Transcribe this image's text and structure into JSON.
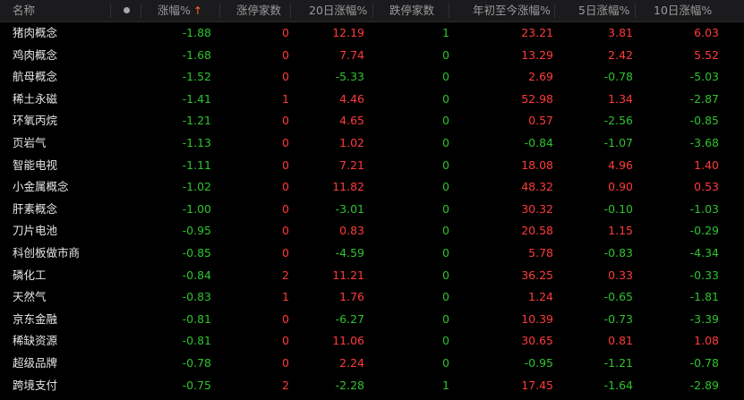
{
  "colors": {
    "up": "#ff3a3a",
    "down": "#2ec22e",
    "neutral": "#e6e6e6",
    "sort_arrow": "#ff6a2b"
  },
  "header": {
    "name": "名称",
    "dot": "dot-icon",
    "chg": "涨幅%",
    "sort_arrow": "↑",
    "limit_up": "涨停家数",
    "chg20": "20日涨幅%",
    "limit_down": "跌停家数",
    "ytd": "年初至今涨幅%",
    "chg5": "5日涨幅%",
    "chg10": "10日涨幅%"
  },
  "rows": [
    {
      "name": "猪肉概念",
      "chg": "-1.88",
      "limit_up": "0",
      "chg20": "12.19",
      "limit_down": "1",
      "ytd": "23.21",
      "chg5": "3.81",
      "chg10": "6.03"
    },
    {
      "name": "鸡肉概念",
      "chg": "-1.68",
      "limit_up": "0",
      "chg20": "7.74",
      "limit_down": "0",
      "ytd": "13.29",
      "chg5": "2.42",
      "chg10": "5.52"
    },
    {
      "name": "航母概念",
      "chg": "-1.52",
      "limit_up": "0",
      "chg20": "-5.33",
      "limit_down": "0",
      "ytd": "2.69",
      "chg5": "-0.78",
      "chg10": "-5.03"
    },
    {
      "name": "稀土永磁",
      "chg": "-1.41",
      "limit_up": "1",
      "chg20": "4.46",
      "limit_down": "0",
      "ytd": "52.98",
      "chg5": "1.34",
      "chg10": "-2.87"
    },
    {
      "name": "环氧丙烷",
      "chg": "-1.21",
      "limit_up": "0",
      "chg20": "4.65",
      "limit_down": "0",
      "ytd": "0.57",
      "chg5": "-2.56",
      "chg10": "-0.85"
    },
    {
      "name": "页岩气",
      "chg": "-1.13",
      "limit_up": "0",
      "chg20": "1.02",
      "limit_down": "0",
      "ytd": "-0.84",
      "chg5": "-1.07",
      "chg10": "-3.68"
    },
    {
      "name": "智能电视",
      "chg": "-1.11",
      "limit_up": "0",
      "chg20": "7.21",
      "limit_down": "0",
      "ytd": "18.08",
      "chg5": "4.96",
      "chg10": "1.40"
    },
    {
      "name": "小金属概念",
      "chg": "-1.02",
      "limit_up": "0",
      "chg20": "11.82",
      "limit_down": "0",
      "ytd": "48.32",
      "chg5": "0.90",
      "chg10": "0.53"
    },
    {
      "name": "肝素概念",
      "chg": "-1.00",
      "limit_up": "0",
      "chg20": "-3.01",
      "limit_down": "0",
      "ytd": "30.32",
      "chg5": "-0.10",
      "chg10": "-1.03"
    },
    {
      "name": "刀片电池",
      "chg": "-0.95",
      "limit_up": "0",
      "chg20": "0.83",
      "limit_down": "0",
      "ytd": "20.58",
      "chg5": "1.15",
      "chg10": "-0.29"
    },
    {
      "name": "科创板做市商",
      "chg": "-0.85",
      "limit_up": "0",
      "chg20": "-4.59",
      "limit_down": "0",
      "ytd": "5.78",
      "chg5": "-0.83",
      "chg10": "-4.34"
    },
    {
      "name": "磷化工",
      "chg": "-0.84",
      "limit_up": "2",
      "chg20": "11.21",
      "limit_down": "0",
      "ytd": "36.25",
      "chg5": "0.33",
      "chg10": "-0.33"
    },
    {
      "name": "天然气",
      "chg": "-0.83",
      "limit_up": "1",
      "chg20": "1.76",
      "limit_down": "0",
      "ytd": "1.24",
      "chg5": "-0.65",
      "chg10": "-1.81"
    },
    {
      "name": "京东金融",
      "chg": "-0.81",
      "limit_up": "0",
      "chg20": "-6.27",
      "limit_down": "0",
      "ytd": "10.39",
      "chg5": "-0.73",
      "chg10": "-3.39"
    },
    {
      "name": "稀缺资源",
      "chg": "-0.81",
      "limit_up": "0",
      "chg20": "11.06",
      "limit_down": "0",
      "ytd": "30.65",
      "chg5": "0.81",
      "chg10": "1.08"
    },
    {
      "name": "超级品牌",
      "chg": "-0.78",
      "limit_up": "0",
      "chg20": "2.24",
      "limit_down": "0",
      "ytd": "-0.95",
      "chg5": "-1.21",
      "chg10": "-0.78"
    },
    {
      "name": "跨境支付",
      "chg": "-0.75",
      "limit_up": "2",
      "chg20": "-2.28",
      "limit_down": "1",
      "ytd": "17.45",
      "chg5": "-1.64",
      "chg10": "-2.89"
    }
  ]
}
